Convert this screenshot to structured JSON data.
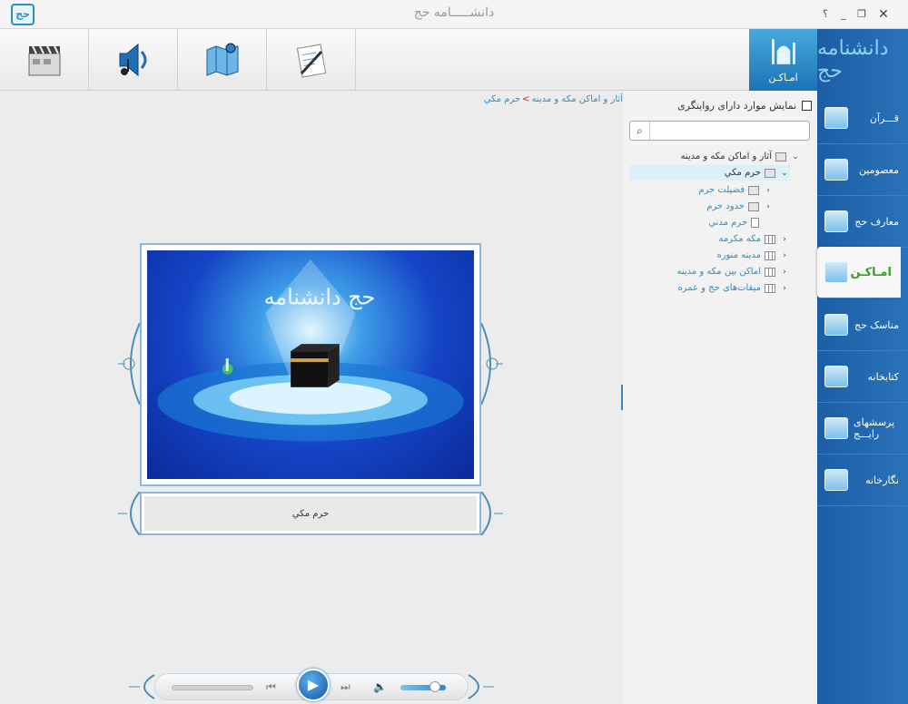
{
  "window": {
    "title": "دانشـــــامه حج",
    "logo_text": "حج",
    "help_label": "؟",
    "minimize_label": "_",
    "maximize_label": "❐",
    "close_label": "✕"
  },
  "toolbar": {
    "tools": [
      {
        "name": "video-tool",
        "icon": "film-clapper-icon"
      },
      {
        "name": "audio-tool",
        "icon": "speaker-icon"
      },
      {
        "name": "map-tool",
        "icon": "map-icon"
      },
      {
        "name": "text-tool",
        "icon": "document-pen-icon"
      }
    ],
    "active_tab_label": "امـاكـن"
  },
  "sidebar": {
    "logo_text": "دانشنامه حج",
    "items": [
      {
        "label": "قـــرآن",
        "icon": "quran-icon"
      },
      {
        "label": "معصومين",
        "icon": "shrine-icon"
      },
      {
        "label": "معارف حج",
        "icon": "book-icon"
      },
      {
        "label": "امـاكـن",
        "icon": "mosque-icon",
        "active": true
      },
      {
        "label": "مناسک حج",
        "icon": "pilgrim-icon"
      },
      {
        "label": "كتابخانه",
        "icon": "library-icon"
      },
      {
        "label": "پرسشهای رايـــج",
        "icon": "question-icon"
      },
      {
        "label": "نگارخانه",
        "icon": "gallery-icon"
      }
    ]
  },
  "tree": {
    "checkbox_label": "نمايش موارد دارای روايتگری",
    "search_placeholder": "",
    "search_icon": "search-icon",
    "nodes": [
      {
        "label": "آثار و اماكن مكه و مدينه",
        "chevron": "⌄",
        "icon": "folder"
      },
      {
        "label": "حرم مكي",
        "chevron": "⌄",
        "icon": "folder"
      },
      {
        "label": "فضيلت حرم",
        "chevron": "›",
        "icon": "doc"
      },
      {
        "label": "حدود حرم",
        "chevron": "›",
        "icon": "doc"
      },
      {
        "label": "حرم مدني",
        "chevron": "",
        "icon": "page"
      },
      {
        "label": "مكه مكرمه",
        "chevron": "›",
        "icon": "book"
      },
      {
        "label": "مدينه منوره",
        "chevron": "›",
        "icon": "book"
      },
      {
        "label": "اماكن بين مكه و مدينه",
        "chevron": "›",
        "icon": "book"
      },
      {
        "label": "ميقات‌های حج و عمره",
        "chevron": "›",
        "icon": "book"
      }
    ]
  },
  "breadcrumb": {
    "parent": "آثار و اماكن مكه و مدينه",
    "separator": ">",
    "current": "حرم مكي"
  },
  "content": {
    "caption": "حرم مكي",
    "image_logo": "حج دانشنامه"
  },
  "media": {
    "play_icon": "▶",
    "prev_icon": "⏮",
    "next_icon": "⏭",
    "volume_icon": "🔈"
  }
}
